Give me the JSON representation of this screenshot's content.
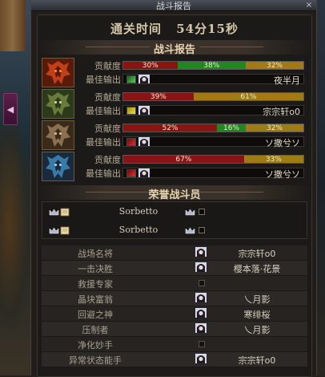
{
  "window": {
    "title": "战斗报告",
    "close_label": "×",
    "side_tab_label": "◀"
  },
  "clear_time": {
    "label": "通关时间",
    "value": "54分15秒"
  },
  "battle_report": {
    "title": "战斗报告",
    "contribution_label": "贡献度",
    "best_output_label": "最佳输出",
    "members": [
      {
        "contribution": [
          {
            "color": "red",
            "percent": 30,
            "text": "30%"
          },
          {
            "color": "green",
            "percent": 38,
            "text": "38%"
          },
          {
            "color": "gold",
            "percent": 32,
            "text": "32%"
          }
        ],
        "weapon_color": "green",
        "best_output_name": "夜半月",
        "portrait_colors": [
          "#c0401a",
          "#5a1a0a",
          "#ff8040"
        ]
      },
      {
        "contribution": [
          {
            "color": "red",
            "percent": 39,
            "text": "39%"
          },
          {
            "color": "gold",
            "percent": 61,
            "text": "61%"
          }
        ],
        "weapon_color": "yellow",
        "best_output_name": "宗宗轩o0",
        "portrait_colors": [
          "#6a7a3a",
          "#2a3a1a",
          "#c8d890"
        ]
      },
      {
        "contribution": [
          {
            "color": "red",
            "percent": 52,
            "text": "52%"
          },
          {
            "color": "green",
            "percent": 16,
            "text": "16%"
          },
          {
            "color": "gold",
            "percent": 32,
            "text": "32%"
          }
        ],
        "weapon_color": "red",
        "best_output_name": "ソ撒兮ソ",
        "portrait_colors": [
          "#8a7050",
          "#3a2a1a",
          "#d8b880"
        ]
      },
      {
        "contribution": [
          {
            "color": "red",
            "percent": 67,
            "text": "67%"
          },
          {
            "color": "gold",
            "percent": 33,
            "text": "33%"
          }
        ],
        "weapon_color": "red",
        "best_output_name": "ソ撒兮ソ",
        "portrait_colors": [
          "#3a7aa8",
          "#1a2a3a",
          "#90d0f0"
        ]
      }
    ]
  },
  "honor": {
    "title": "荣誉战斗员",
    "rows": [
      {
        "name": "Sorbetto"
      },
      {
        "name": "Sorbetto"
      }
    ]
  },
  "awards": [
    {
      "title": "战场名将",
      "player": "宗宗轩o0",
      "has_avatar": true
    },
    {
      "title": "一击决胜",
      "player": "樱本落·花景",
      "has_avatar": true
    },
    {
      "title": "救援专家",
      "player": "",
      "has_avatar": false
    },
    {
      "title": "晶块富翁",
      "player": "乀月影",
      "has_avatar": true
    },
    {
      "title": "回避之神",
      "player": "寒绯桜",
      "has_avatar": true
    },
    {
      "title": "压制者",
      "player": "乀月影",
      "has_avatar": true
    },
    {
      "title": "净化妙手",
      "player": "",
      "has_avatar": false
    },
    {
      "title": "异常状态能手",
      "player": "宗宗轩o0",
      "has_avatar": true
    }
  ]
}
